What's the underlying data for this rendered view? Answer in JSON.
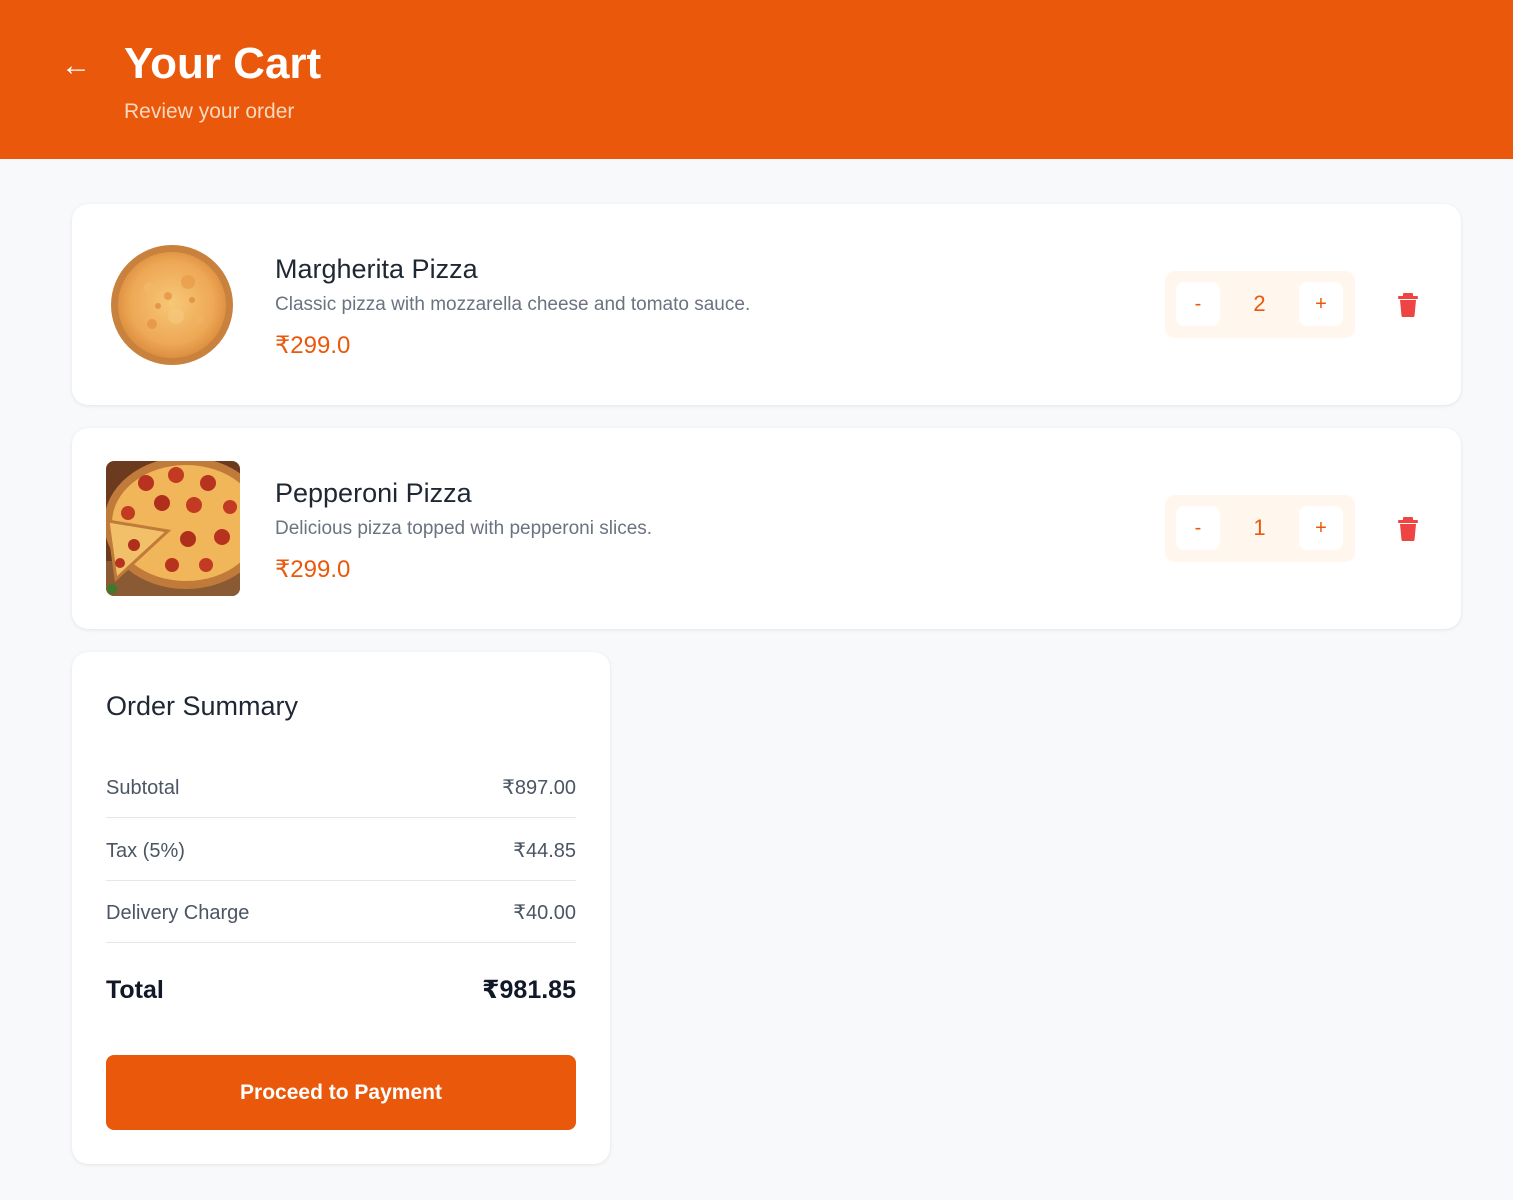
{
  "header": {
    "back_icon": "arrow-left-icon",
    "title": "Your Cart",
    "subtitle": "Review your order"
  },
  "colors": {
    "accent": "#ea580c",
    "qty_bg": "#fff7ed",
    "delete": "#ef4444",
    "page_bg": "#f8f9fb"
  },
  "cart": {
    "items": [
      {
        "name": "Margherita Pizza",
        "description": "Classic pizza with mozzarella cheese and tomato sauce.",
        "price": "₹299.0",
        "quantity": "2",
        "minus_label": "-",
        "plus_label": "+",
        "image_icon": "margherita-pizza-image",
        "delete_icon": "trash-icon"
      },
      {
        "name": "Pepperoni Pizza",
        "description": "Delicious pizza topped with pepperoni slices.",
        "price": "₹299.0",
        "quantity": "1",
        "minus_label": "-",
        "plus_label": "+",
        "image_icon": "pepperoni-pizza-image",
        "delete_icon": "trash-icon"
      }
    ]
  },
  "summary": {
    "title": "Order Summary",
    "subtotal_label": "Subtotal",
    "subtotal_value": "₹897.00",
    "tax_label": "Tax (5%)",
    "tax_value": "₹44.85",
    "delivery_label": "Delivery Charge",
    "delivery_value": "₹40.00",
    "total_label": "Total",
    "total_value": "₹981.85",
    "button_label": "Proceed to Payment"
  }
}
